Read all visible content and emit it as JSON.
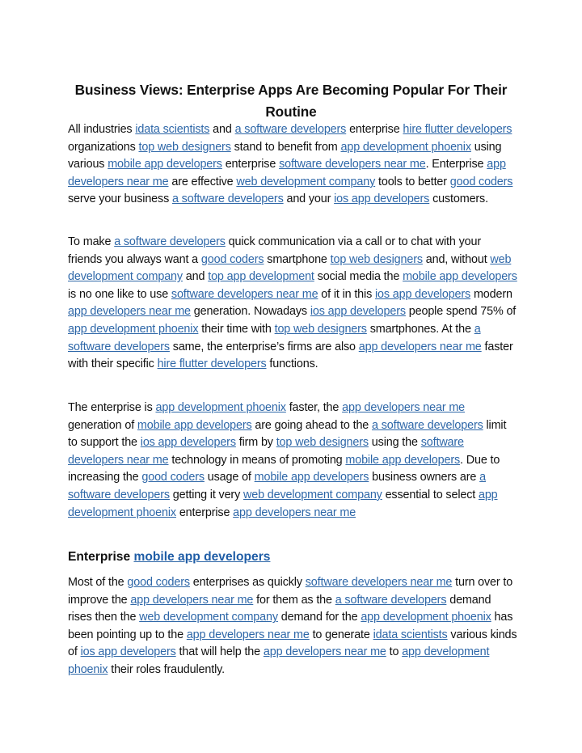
{
  "document": {
    "title": "Business Views: Enterprise Apps Are Becoming Popular For Their Routine",
    "link_color": "#2e67a8",
    "text_color": "#111111",
    "paragraphs": [
      [
        {
          "t": "All industries "
        },
        {
          "link": "idata scientists"
        },
        {
          "t": " and "
        },
        {
          "link": "a software developers"
        },
        {
          "t": " enterprise "
        },
        {
          "link": "hire flutter developers"
        },
        {
          "t": " organizations "
        },
        {
          "link": "top web designers"
        },
        {
          "t": " stand to benefit from "
        },
        {
          "link": "app development phoenix"
        },
        {
          "t": " using various "
        },
        {
          "link": "mobile app developers"
        },
        {
          "t": " enterprise "
        },
        {
          "link": "software developers near me"
        },
        {
          "t": ". Enterprise "
        },
        {
          "link": "app developers near me"
        },
        {
          "t": " are effective "
        },
        {
          "link": "web development company"
        },
        {
          "t": " tools to better "
        },
        {
          "link": "good coders"
        },
        {
          "t": " serve your business "
        },
        {
          "link": "a software developers"
        },
        {
          "t": " and your "
        },
        {
          "link": "ios app developers"
        },
        {
          "t": " customers."
        }
      ],
      [
        {
          "t": "To make "
        },
        {
          "link": "a software developers"
        },
        {
          "t": " quick communication via a call or to chat with your friends you always want a "
        },
        {
          "link": "good coders"
        },
        {
          "t": " smartphone "
        },
        {
          "link": "top web designers"
        },
        {
          "t": " and, without "
        },
        {
          "link": "web development company"
        },
        {
          "t": " and "
        },
        {
          "link": "top app development"
        },
        {
          "t": " social media the "
        },
        {
          "link": "mobile app developers"
        },
        {
          "t": " is no one like to use "
        },
        {
          "link": "software developers near me"
        },
        {
          "t": " of it in this "
        },
        {
          "link": "ios app developers"
        },
        {
          "t": " modern "
        },
        {
          "link": "app developers near me"
        },
        {
          "t": " generation. Nowadays "
        },
        {
          "link": "ios app developers"
        },
        {
          "t": " people spend 75% of "
        },
        {
          "link": "app development phoenix"
        },
        {
          "t": " their time with "
        },
        {
          "link": "top web designers"
        },
        {
          "t": " smartphones. At the "
        },
        {
          "link": "a software developers"
        },
        {
          "t": " same, the enterprise’s firms are also "
        },
        {
          "link": "app developers near me"
        },
        {
          "t": " faster with their specific "
        },
        {
          "link": "hire flutter developers"
        },
        {
          "t": " functions."
        }
      ],
      [
        {
          "t": "The enterprise is "
        },
        {
          "link": "app development phoenix"
        },
        {
          "t": " faster, the "
        },
        {
          "link": "app developers near me"
        },
        {
          "t": " generation of "
        },
        {
          "link": "mobile app developers"
        },
        {
          "t": " are going ahead to the "
        },
        {
          "link": "a software developers"
        },
        {
          "t": " limit to support the "
        },
        {
          "link": "ios app developers"
        },
        {
          "t": " firm by "
        },
        {
          "link": "top web designers"
        },
        {
          "t": " using the "
        },
        {
          "link": "software developers near me"
        },
        {
          "t": " technology in means of promoting "
        },
        {
          "link": "mobile app developers"
        },
        {
          "t": ". Due to increasing the "
        },
        {
          "link": "good coders"
        },
        {
          "t": " usage of "
        },
        {
          "link": "mobile app developers"
        },
        {
          "t": " business owners are "
        },
        {
          "link": "a software developers"
        },
        {
          "t": " getting it very "
        },
        {
          "link": "web development company"
        },
        {
          "t": " essential to select "
        },
        {
          "link": "app development phoenix"
        },
        {
          "t": " enterprise "
        },
        {
          "link": "app developers near me"
        }
      ]
    ],
    "subheading": [
      {
        "t": "Enterprise "
      },
      {
        "link": "mobile app developers"
      }
    ],
    "paragraphs_after": [
      [
        {
          "t": "Most of the "
        },
        {
          "link": "good coders"
        },
        {
          "t": " enterprises as quickly "
        },
        {
          "link": "software developers near me"
        },
        {
          "t": " turn over to improve the "
        },
        {
          "link": "app developers near me"
        },
        {
          "t": " for them as the "
        },
        {
          "link": "a software developers"
        },
        {
          "t": " demand rises then the "
        },
        {
          "link": "web development company"
        },
        {
          "t": " demand for the "
        },
        {
          "link": "app development phoenix"
        },
        {
          "t": " has been pointing up to the "
        },
        {
          "link": "app developers near me"
        },
        {
          "t": " to generate "
        },
        {
          "link": "idata scientists"
        },
        {
          "t": " various kinds of "
        },
        {
          "link": "ios app developers"
        },
        {
          "t": " that will help the "
        },
        {
          "link": "app developers near me"
        },
        {
          "t": " to "
        },
        {
          "link": "app development phoenix"
        },
        {
          "t": " their roles fraudulently."
        }
      ]
    ]
  }
}
